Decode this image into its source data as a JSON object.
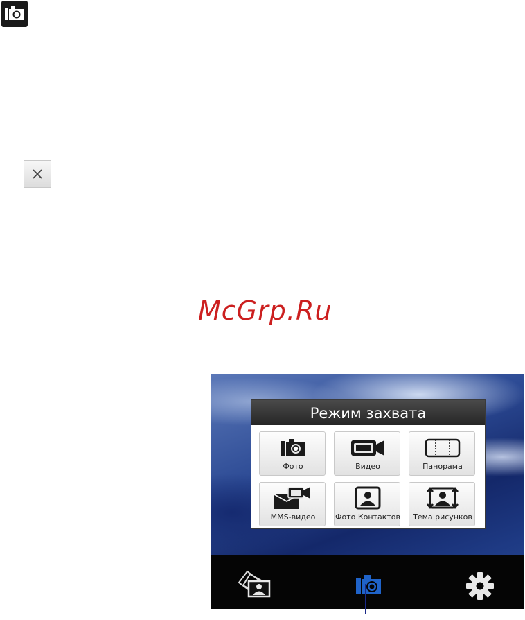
{
  "icons": {
    "top_icon": "camera-icon",
    "close": "close-icon",
    "album": "album-icon",
    "capture_mode": "camera-icon",
    "settings": "gear-icon"
  },
  "watermark": "McGrp.Ru",
  "dialog": {
    "title": "Режим захвата",
    "modes": [
      {
        "label": "Фото",
        "icon": "camera-icon"
      },
      {
        "label": "Видео",
        "icon": "video-camera-icon"
      },
      {
        "label": "Панорама",
        "icon": "panorama-icon"
      },
      {
        "label": "MMS-видео",
        "icon": "mms-video-icon"
      },
      {
        "label": "Фото Контактов",
        "icon": "contact-photo-icon"
      },
      {
        "label": "Тема рисунков",
        "icon": "picture-theme-icon"
      }
    ]
  },
  "colors": {
    "capture_active": "#1f63c9",
    "pointer": "#1a2a88",
    "watermark": "#cc1f1f"
  }
}
